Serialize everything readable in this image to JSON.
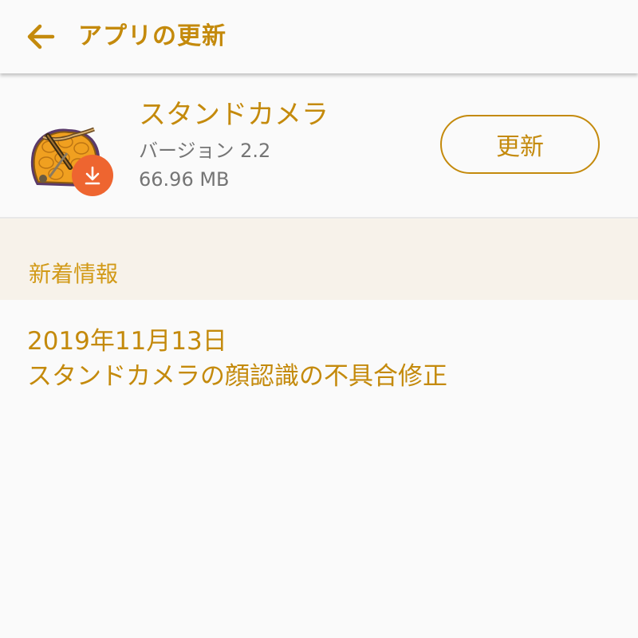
{
  "colors": {
    "accent": "#c48a0c",
    "section_header_bg": "#f7f2ea",
    "badge": "#ee6530",
    "secondary_text": "#757575"
  },
  "appbar": {
    "back_icon": "arrow-left-icon",
    "title": "アプリの更新"
  },
  "app": {
    "icon": "app-icon-crossbow",
    "badge_icon": "download-icon",
    "name": "スタンドカメラ",
    "version": "バージョン 2.2",
    "size": "66.96 MB",
    "update_label": "更新"
  },
  "whats_new": {
    "title": "新着情報",
    "date": "2019年11月13日",
    "text": "スタンドカメラの顔認識の不具合修正"
  }
}
